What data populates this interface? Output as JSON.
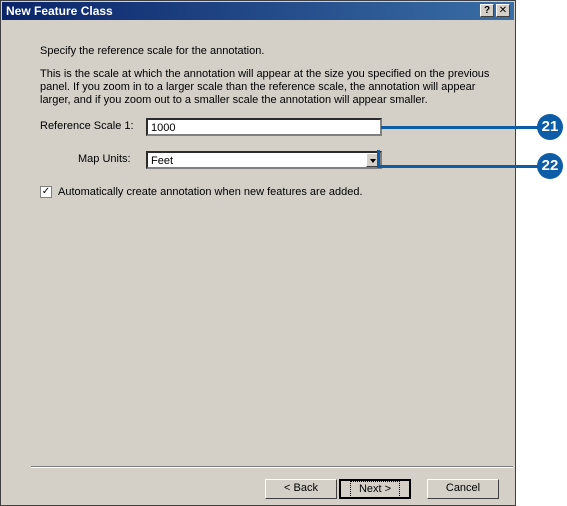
{
  "dialog": {
    "title": "New Feature Class",
    "help_label": "?",
    "close_label": "✕"
  },
  "content": {
    "intro": "Specify the reference scale for the annotation.",
    "description": "This is the scale at which the annotation will appear at the size you specified on the previous panel.  If you zoom in to a larger scale than the reference scale, the annotation will appear larger, and if you zoom out to a smaller scale the annotation will appear smaller.",
    "reference_scale_label": "Reference Scale 1:",
    "reference_scale_value": "1000",
    "map_units_label": "Map Units:",
    "map_units_value": "Feet",
    "checkbox_label": "Automatically create annotation when new features are added.",
    "checkbox_mark": "✓"
  },
  "buttons": {
    "back": "< Back",
    "next": "Next >",
    "cancel": "Cancel"
  },
  "callouts": {
    "first": "21",
    "second": "22",
    "color": "#0d5ca8"
  }
}
